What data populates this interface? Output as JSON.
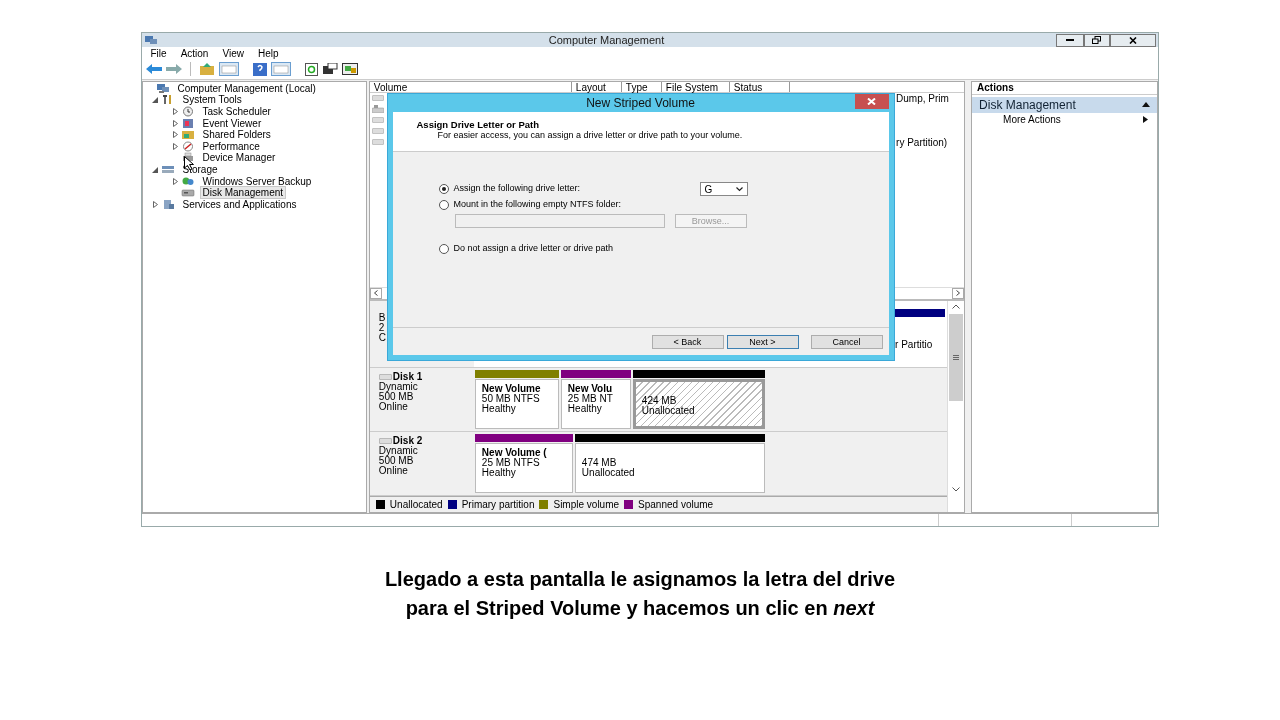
{
  "window": {
    "title": "Computer Management"
  },
  "menu": [
    "File",
    "Action",
    "View",
    "Help"
  ],
  "tree": [
    {
      "label": "Computer Management (Local)",
      "kind": "computer",
      "selected": false,
      "children": [
        {
          "label": "System Tools",
          "kind": "tools",
          "expanded": true,
          "selected": false,
          "children": [
            {
              "label": "Task Scheduler",
              "kind": "clock",
              "expanded": false,
              "selected": false
            },
            {
              "label": "Event Viewer",
              "kind": "viewer",
              "expanded": false,
              "selected": false
            },
            {
              "label": "Shared Folders",
              "kind": "folder",
              "expanded": false,
              "selected": false
            },
            {
              "label": "Performance",
              "kind": "gauge",
              "expanded": false,
              "selected": false
            },
            {
              "label": "Device Manager",
              "kind": "device",
              "selected": false
            }
          ]
        },
        {
          "label": "Storage",
          "kind": "storage",
          "expanded": true,
          "selected": false,
          "children": [
            {
              "label": "Windows Server Backup",
              "kind": "backup",
              "expanded": false,
              "selected": false
            },
            {
              "label": "Disk Management",
              "kind": "disk",
              "selected": true
            }
          ]
        },
        {
          "label": "Services and Applications",
          "kind": "services",
          "expanded": false,
          "selected": false
        }
      ]
    }
  ],
  "columns": [
    "Volume",
    "Layout",
    "Type",
    "File System",
    "Status"
  ],
  "rows": [
    {
      "kind": "volume",
      "column_6": "Dump, Prim"
    },
    {
      "kind": "system"
    },
    {
      "kind": "volume"
    },
    {
      "kind": "volume"
    },
    {
      "kind": "volume",
      "column_6": "ry Partition)"
    }
  ],
  "disk_0": {
    "label_fragments": [
      "B",
      "2",
      "C"
    ],
    "partition": {
      "color": "#000080",
      "text": "r Partitio"
    }
  },
  "disks": [
    {
      "name": "Disk 1",
      "type": "Dynamic",
      "size": "500 MB",
      "status": "Online",
      "partitions": [
        {
          "name": "New Volume",
          "detail": "50 MB NTFS",
          "status": "Healthy",
          "color": "#808000",
          "selected": false
        },
        {
          "name": "New Volu",
          "detail": "25 MB NT",
          "status": "Healthy",
          "color": "#800080",
          "selected": false
        },
        {
          "detail": "424 MB",
          "status": "Unallocated",
          "color": "#000000",
          "selected": true
        }
      ]
    },
    {
      "name": "Disk 2",
      "type": "Dynamic",
      "size": "500 MB",
      "status": "Online",
      "partitions": [
        {
          "name": "New Volume (",
          "detail": "25 MB NTFS",
          "status": "Healthy",
          "color": "#800080",
          "selected": false
        },
        {
          "detail": "474 MB",
          "status": "Unallocated",
          "color": "#000000",
          "selected": false
        }
      ]
    }
  ],
  "legend": [
    {
      "label": "Unallocated",
      "color": "#000000"
    },
    {
      "label": "Primary partition",
      "color": "#000080"
    },
    {
      "label": "Simple volume",
      "color": "#808000"
    },
    {
      "label": "Spanned volume",
      "color": "#800080"
    }
  ],
  "actions": {
    "title": "Actions",
    "section": "Disk Management",
    "items": [
      "More Actions"
    ]
  },
  "dialog": {
    "title": "New Striped Volume",
    "heading": "Assign Drive Letter or Path",
    "subheading": "For easier access, you can assign a drive letter or drive path to your volume.",
    "options": [
      {
        "kind": "letter",
        "label": "Assign the following drive letter:",
        "selected": true,
        "value": "G"
      },
      {
        "kind": "folder",
        "label": "Mount in the following empty NTFS folder:",
        "selected": false,
        "disabled": true,
        "button": "Browse..."
      },
      {
        "kind": "plain",
        "label": "Do not assign a drive letter or drive path",
        "selected": false
      }
    ],
    "buttons": [
      {
        "label": "< Back",
        "focused": false
      },
      {
        "label": "Next >",
        "focused": true
      },
      {
        "label": "Cancel",
        "focused": false
      }
    ]
  },
  "caption": [
    "Llegado a esta pantalla le asignamos la letra del drive",
    "para el Striped Volume y hacemos un clic en *next*"
  ]
}
